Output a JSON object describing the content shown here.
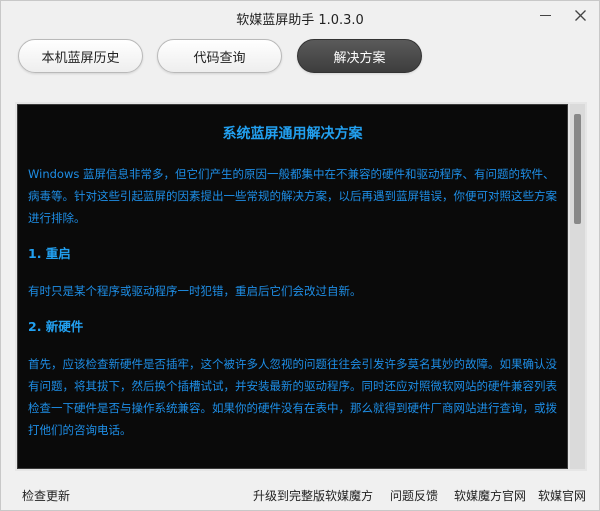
{
  "window": {
    "title": "软媒蓝屏助手 1.0.3.0"
  },
  "tabs": [
    {
      "label": "本机蓝屏历史"
    },
    {
      "label": "代码查询"
    },
    {
      "label": "解决方案"
    }
  ],
  "content": {
    "title": "系统蓝屏通用解决方案",
    "intro": "Windows 蓝屏信息非常多，但它们产生的原因一般都集中在不兼容的硬件和驱动程序、有问题的软件、病毒等。针对这些引起蓝屏的因素提出一些常规的解决方案，以后再遇到蓝屏错误，你便可对照这些方案进行排除。",
    "sections": [
      {
        "heading": "1. 重启",
        "text": "有时只是某个程序或驱动程序一时犯错，重启后它们会改过自新。"
      },
      {
        "heading": "2. 新硬件",
        "text": "首先，应该检查新硬件是否插牢，这个被许多人忽视的问题往往会引发许多莫名其妙的故障。如果确认没有问题，将其拔下，然后换个插槽试试，并安装最新的驱动程序。同时还应对照微软网站的硬件兼容列表检查一下硬件是否与操作系统兼容。如果你的硬件没有在表中，那么就得到硬件厂商网站进行查询，或拨打他们的咨询电话。"
      }
    ]
  },
  "footer": {
    "check_update": "检查更新",
    "upgrade": "升级到完整版软媒魔方",
    "feedback": "问题反馈",
    "mofang_site": "软媒魔方官网",
    "ruanmei_site": "软媒官网"
  },
  "colors": {
    "content_bg": "#0a0a0a",
    "content_text": "#1e8ee6",
    "active_tab": "#3d3d3d"
  }
}
